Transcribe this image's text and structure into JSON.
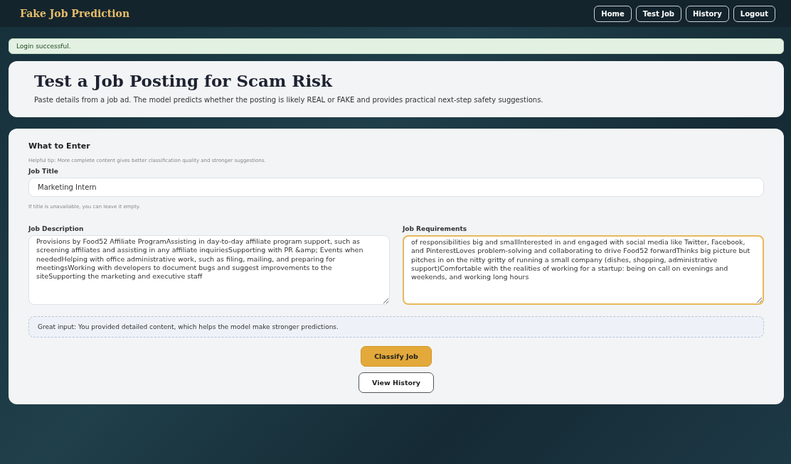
{
  "navbar": {
    "brand": "Fake Job Prediction",
    "links": [
      {
        "label": "Home"
      },
      {
        "label": "Test Job"
      },
      {
        "label": "History"
      },
      {
        "label": "Logout"
      }
    ]
  },
  "alert": {
    "text": "Login successful."
  },
  "header": {
    "title": "Test a Job Posting for Scam Risk",
    "description": "Paste details from a job ad. The model predicts whether the posting is likely REAL or FAKE and provides practical next-step safety suggestions."
  },
  "form": {
    "heading": "What to Enter",
    "tip": "Helpful tip: More complete content gives better classification quality and stronger suggestions.",
    "job_title": {
      "label": "Job Title",
      "value": "Marketing Intern",
      "hint": "If title is unavailable, you can leave it empty."
    },
    "job_description": {
      "label": "Job Description",
      "value": "Provisions by Food52 Affiliate ProgramAssisting in day-to-day affiliate program support, such as screening affiliates and assisting in any affiliate inquiriesSupporting with PR &amp; Events when neededHelping with office administrative work, such as filing, mailing, and preparing for meetingsWorking with developers to document bugs and suggest improvements to the siteSupporting the marketing and executive staff",
      "focused": false
    },
    "job_requirements": {
      "label": "Job Requirements",
      "value": "of responsibilities big and smallInterested in and engaged with social media like Twitter, Facebook, and PinterestLoves problem-solving and collaborating to drive Food52 forwardThinks big picture but pitches in on the nitty gritty of running a small company (dishes, shopping, administrative support)Comfortable with the realities of working for a startup: being on call on evenings and weekends, and working long hours",
      "focused": true
    },
    "feedback": "Great input: You provided detailed content, which helps the model make stronger predictions.",
    "buttons": [
      {
        "label": "Classify Job",
        "kind": "primary"
      },
      {
        "label": "View History",
        "kind": "secondary"
      }
    ]
  }
}
